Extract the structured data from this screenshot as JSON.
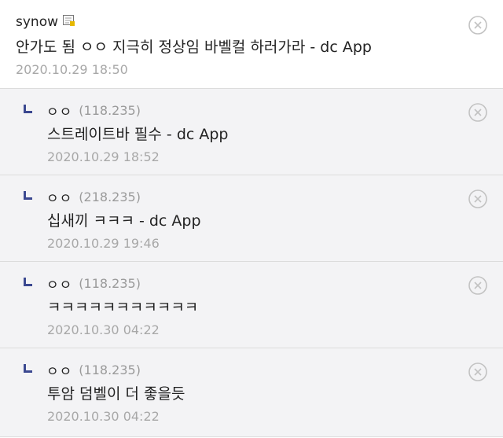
{
  "comments": [
    {
      "author": "synow",
      "text": "안가도 됨 ㅇㅇ 지극히 정상임 바벨컬 하러가라 - dc App",
      "date": "2020.10.29 18:50"
    }
  ],
  "replies": [
    {
      "author": "ㅇㅇ",
      "ip": "(118.235)",
      "text": "스트레이트바 필수 - dc App",
      "date": "2020.10.29 18:52"
    },
    {
      "author": "ㅇㅇ",
      "ip": "(218.235)",
      "text": "십새끼 ㅋㅋㅋ - dc App",
      "date": "2020.10.29 19:46"
    },
    {
      "author": "ㅇㅇ",
      "ip": "(118.235)",
      "text": "ㅋㅋㅋㅋㅋㅋㅋㅋㅋㅋㅋ",
      "date": "2020.10.30 04:22"
    },
    {
      "author": "ㅇㅇ",
      "ip": "(118.235)",
      "text": "투암 덤벨이 더 좋을듯",
      "date": "2020.10.30 04:22"
    }
  ],
  "colors": {
    "reply_bg": "#f3f3f5",
    "reply_marker": "#3b4890",
    "meta_text": "#a8a8a8"
  },
  "icons": {
    "user_badge": "memo-icon",
    "delete": "close-circle-icon",
    "reply": "reply-arrow-icon"
  }
}
